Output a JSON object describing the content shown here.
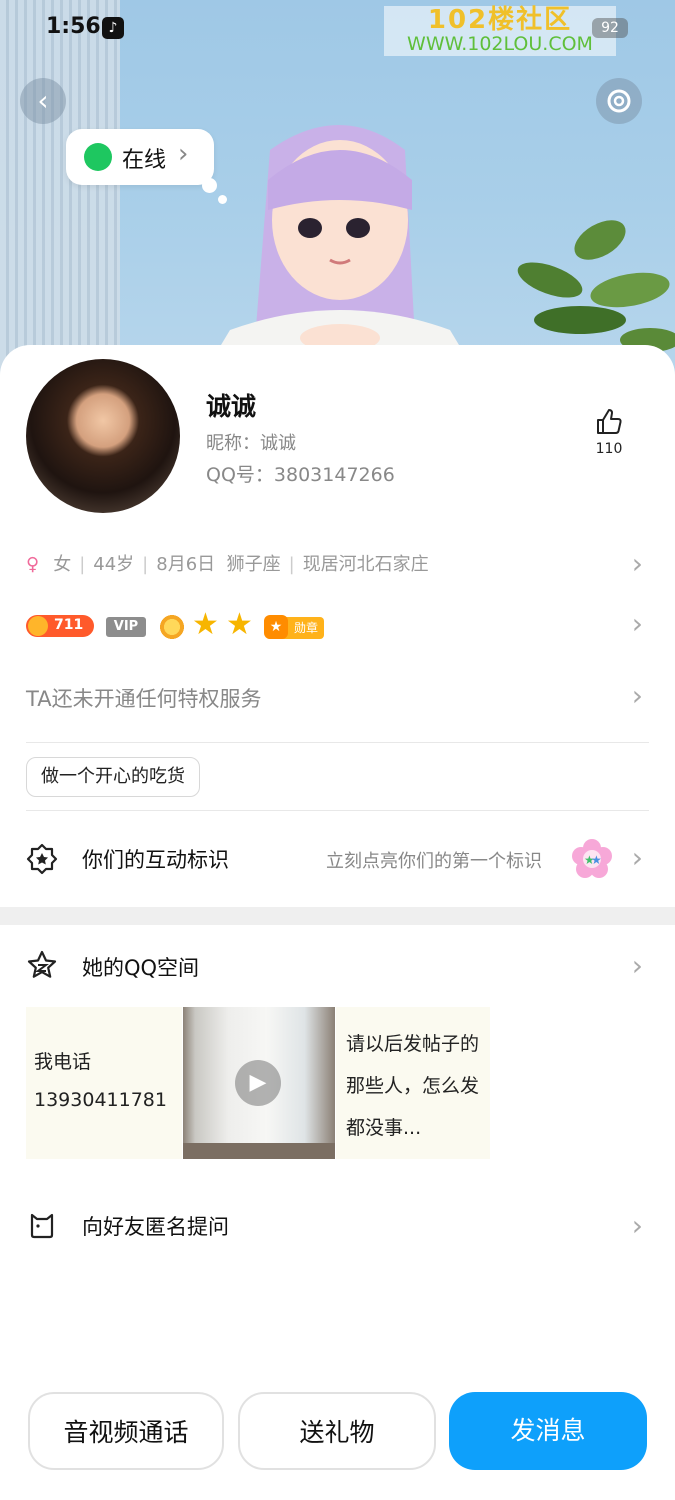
{
  "status_bar": {
    "time": "1:56",
    "battery": "92"
  },
  "watermark": {
    "line1": "102楼社区",
    "line2": "WWW.102LOU.COM"
  },
  "hero": {
    "online_status": "在线"
  },
  "profile": {
    "name": "诚诚",
    "nickname": "昵称：诚诚",
    "qq": "QQ号：3803147266",
    "likes": "110"
  },
  "info": {
    "gender": "女",
    "age": "44岁",
    "birthday": "8月6日",
    "zodiac": "狮子座",
    "location": "现居河北石家庄"
  },
  "badges": {
    "level": "711",
    "vip": "VIP",
    "medal": "勋章"
  },
  "privilege_text": "TA还未开通任何特权服务",
  "tag": "做一个开心的吃货",
  "interaction": {
    "title": "你们的互动标识",
    "subtitle": "立刻点亮你们的第一个标识"
  },
  "qzone": {
    "title": "她的QQ空间",
    "post1_line1": "我电话",
    "post1_line2": "13930411781",
    "post3": "请以后发帖子的那些人，怎么发都没事..."
  },
  "anon_question": "向好友匿名提问",
  "buttons": {
    "call": "音视频通话",
    "gift": "送礼物",
    "message": "发消息"
  },
  "colors": {
    "accent": "#0ea0fb",
    "online": "#1ec760",
    "female": "#f06a9a"
  }
}
